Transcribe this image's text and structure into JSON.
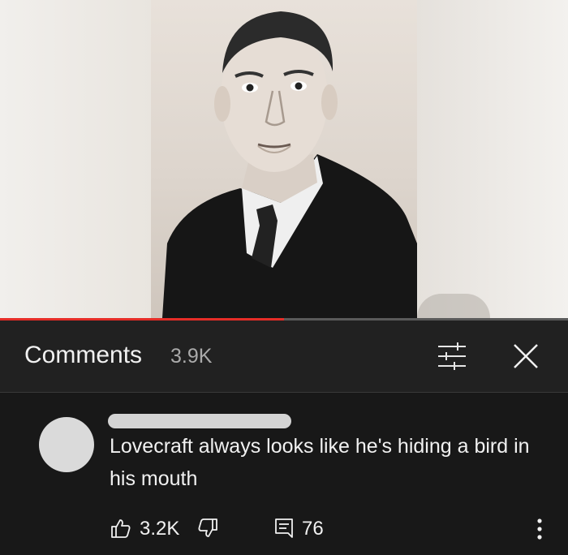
{
  "video": {
    "progress_fraction": 0.5
  },
  "comments_header": {
    "title": "Comments",
    "count": "3.9K",
    "filter_icon": "sort-sliders-icon",
    "close_icon": "close-icon"
  },
  "comment": {
    "text": "Lovecraft always looks like he's hiding a bird in his mouth",
    "likes": "3.2K",
    "replies": "76",
    "icons": {
      "like": "thumbs-up-icon",
      "dislike": "thumbs-down-icon",
      "reply": "reply-icon",
      "more": "more-vert-icon"
    }
  },
  "colors": {
    "progress": "#e52d27",
    "panel": "#212121",
    "text": "#f1f1f1",
    "secondary_text": "#aaaaaa"
  }
}
